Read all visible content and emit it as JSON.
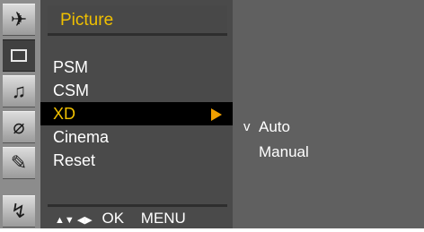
{
  "sidebar": {
    "icons": [
      {
        "name": "antenna-icon",
        "glyph": "✈"
      },
      {
        "name": "picture-icon",
        "glyph": ""
      },
      {
        "name": "audio-icon",
        "glyph": "♫"
      },
      {
        "name": "time-icon",
        "glyph": "⌀"
      },
      {
        "name": "option-icon",
        "glyph": "✎"
      },
      {
        "name": "input-icon",
        "glyph": "↯"
      }
    ]
  },
  "menu": {
    "title": "Picture",
    "items": [
      {
        "label": "PSM"
      },
      {
        "label": "CSM"
      },
      {
        "label": "XD"
      },
      {
        "label": "Cinema"
      },
      {
        "label": "Reset"
      }
    ],
    "selected_index": 2
  },
  "help": {
    "glyphs": "▲▼ ◀▶",
    "ok_label": "OK",
    "menu_label": "MENU"
  },
  "submenu": {
    "items": [
      {
        "check": "v",
        "label": "Auto"
      },
      {
        "check": "",
        "label": "Manual"
      }
    ]
  },
  "colors": {
    "highlight_text": "#f0c000",
    "arrow": "#f0a000",
    "selected_bg": "#000000",
    "menu_bg": "#4a4a4a",
    "submenu_bg": "#606060"
  }
}
